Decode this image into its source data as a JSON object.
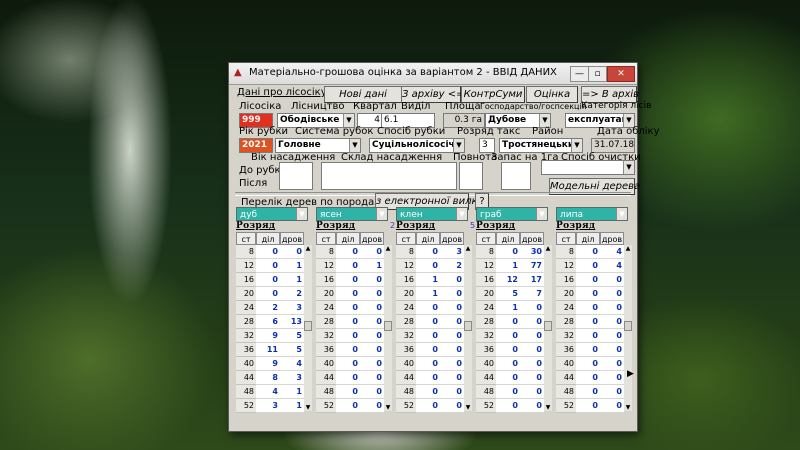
{
  "window": {
    "title": "Матеріально-грошова оцінка за варіантом 2 - ВВІД ДАНИХ",
    "controls": [
      "—",
      "▫",
      "✕"
    ]
  },
  "toolbar": {
    "forest_data": "Дані про лісосіку",
    "new_data": "Нові дані",
    "from_archive": "З архіву <=",
    "control_sums": "КонтрСуми",
    "assessment": "Оцінка",
    "to_archive": "=> В архів"
  },
  "row1_labels": {
    "lisosika": "Лісосіка",
    "lisnytstvo": "Лісництво",
    "kvartal": "Квартал",
    "vydil": "Виділ",
    "ploshcha": "Площа",
    "gospodarstvo": "Господарство/госпсекція",
    "kategoriya": "Категорія лісів"
  },
  "row1_values": {
    "lisosika": "999",
    "lisnytstvo": "Ободівське",
    "kvartal": "4",
    "vydil": "6.1",
    "ploshcha": "0.3 га",
    "gospodarstvo": "Дубове",
    "kategoriya": "експлуатаційні"
  },
  "row2_labels": {
    "rik_rubky": "Рік рубки",
    "systema": "Система рубок",
    "sposib": "Спосіб рубки",
    "rozriad": "Розряд такс",
    "raion": "Район",
    "data_obliku": "Дата обліку"
  },
  "row2_values": {
    "rik_rubky": "2021",
    "systema": "Головне",
    "sposib": "Суцільнолісосічна",
    "rozriad": "3",
    "raion": "Тростянецький",
    "data_obliku": "31.07.18"
  },
  "row3_labels": {
    "vik": "Вік насадження",
    "sklad": "Склад насадження",
    "povnota": "Повнота",
    "zapas": "Запас на 1га",
    "sposib_ochystky": "Спосіб очистки"
  },
  "row4_labels": {
    "do_rubky": "До рубки",
    "pislia": "Після",
    "model_trees": "Модельні дерева"
  },
  "species_section": {
    "title": "Перелік дерев по породах",
    "from_fork": "з електронної вилки",
    "help": "?"
  },
  "columns": {
    "caption": "Розряд",
    "st": "ст",
    "dil": "діл",
    "drov": "дров"
  },
  "species": [
    {
      "name": "дуб",
      "tag": "",
      "st": [
        "8",
        "12",
        "16",
        "20",
        "24",
        "28",
        "32",
        "36",
        "40",
        "44",
        "48",
        "52"
      ],
      "dil": [
        "0",
        "0",
        "0",
        "0",
        "2",
        "6",
        "9",
        "11",
        "9",
        "8",
        "4",
        "3"
      ],
      "drov": [
        "0",
        "1",
        "1",
        "2",
        "3",
        "13",
        "5",
        "5",
        "4",
        "3",
        "1",
        "1"
      ]
    },
    {
      "name": "ясен",
      "tag": "2",
      "st": [
        "8",
        "12",
        "16",
        "20",
        "24",
        "28",
        "32",
        "36",
        "40",
        "44",
        "48",
        "52"
      ],
      "dil": [
        "0",
        "0",
        "0",
        "0",
        "0",
        "0",
        "0",
        "0",
        "0",
        "0",
        "0",
        "0"
      ],
      "drov": [
        "0",
        "1",
        "0",
        "0",
        "0",
        "0",
        "0",
        "0",
        "0",
        "0",
        "0",
        "0"
      ]
    },
    {
      "name": "клен",
      "tag": "5",
      "st": [
        "8",
        "12",
        "16",
        "20",
        "24",
        "28",
        "32",
        "36",
        "40",
        "44",
        "48",
        "52"
      ],
      "dil": [
        "0",
        "0",
        "1",
        "1",
        "0",
        "0",
        "0",
        "0",
        "0",
        "0",
        "0",
        "0"
      ],
      "drov": [
        "3",
        "2",
        "0",
        "0",
        "0",
        "0",
        "0",
        "0",
        "0",
        "0",
        "0",
        "0"
      ]
    },
    {
      "name": "граб",
      "tag": "",
      "st": [
        "8",
        "12",
        "16",
        "20",
        "24",
        "28",
        "32",
        "36",
        "40",
        "44",
        "48",
        "52"
      ],
      "dil": [
        "0",
        "1",
        "12",
        "5",
        "1",
        "0",
        "0",
        "0",
        "0",
        "0",
        "0",
        "0"
      ],
      "drov": [
        "30",
        "77",
        "17",
        "7",
        "0",
        "0",
        "0",
        "0",
        "0",
        "0",
        "0",
        "0"
      ]
    },
    {
      "name": "липа",
      "tag": "",
      "st": [
        "8",
        "12",
        "16",
        "20",
        "24",
        "28",
        "32",
        "36",
        "40",
        "44",
        "48",
        "52"
      ],
      "dil": [
        "0",
        "0",
        "0",
        "0",
        "0",
        "0",
        "0",
        "0",
        "0",
        "0",
        "0",
        "0"
      ],
      "drov": [
        "4",
        "4",
        "0",
        "0",
        "0",
        "0",
        "0",
        "0",
        "0",
        "0",
        "0",
        "0"
      ]
    }
  ]
}
